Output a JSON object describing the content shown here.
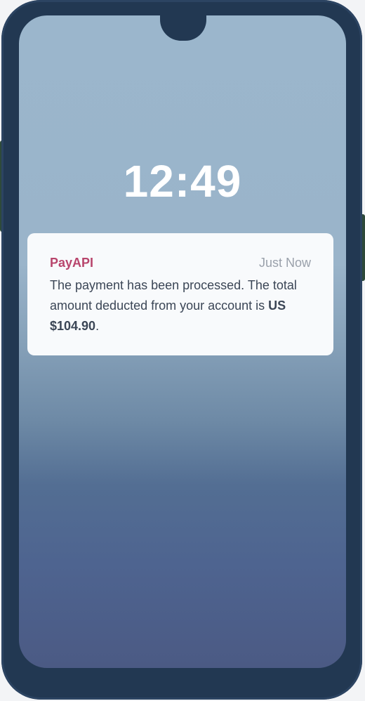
{
  "lockscreen": {
    "time": "12:49"
  },
  "notification": {
    "app_name": "PayAPI",
    "time_ago": "Just Now",
    "message_prefix": "The payment has been processed. The total amount deducted from your account is ",
    "amount": "US $104.90",
    "message_suffix": "."
  },
  "colors": {
    "frame": "#223852",
    "accent": "#b8456c",
    "card": "#f8fafc",
    "text": "#3b4656",
    "muted": "#9aa1ab"
  }
}
